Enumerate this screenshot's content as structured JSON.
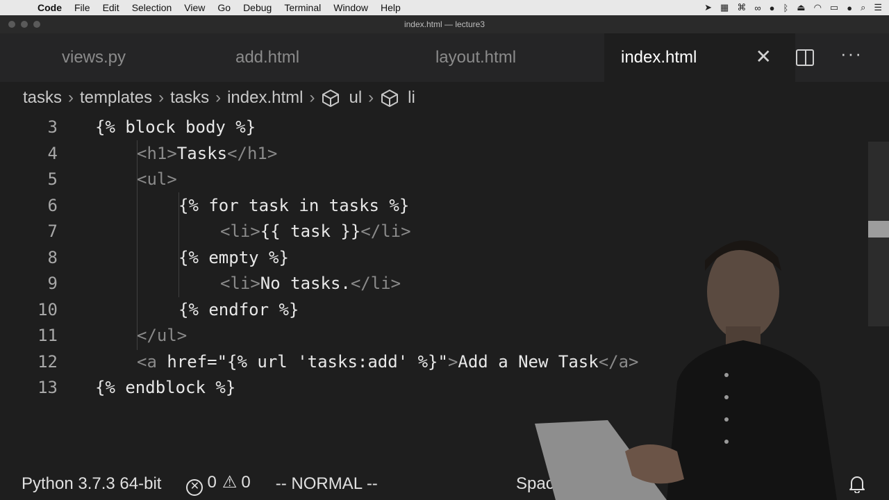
{
  "menubar": {
    "app": "Code",
    "items": [
      "File",
      "Edit",
      "Selection",
      "View",
      "Go",
      "Debug",
      "Terminal",
      "Window",
      "Help"
    ]
  },
  "window": {
    "title": "index.html — lecture3"
  },
  "tabs": [
    {
      "label": "views.py",
      "active": false
    },
    {
      "label": "add.html",
      "active": false
    },
    {
      "label": "layout.html",
      "active": false
    },
    {
      "label": "index.html",
      "active": true
    }
  ],
  "breadcrumb": [
    "tasks",
    "templates",
    "tasks",
    "index.html",
    "ul",
    "li"
  ],
  "editor": {
    "lines": [
      {
        "n": "3",
        "indent": 0,
        "parts": [
          [
            "txt",
            "{% block body %}"
          ]
        ]
      },
      {
        "n": "4",
        "indent": 1,
        "parts": [
          [
            "tag",
            "<h1>"
          ],
          [
            "txt",
            "Tasks"
          ],
          [
            "tag",
            "</h1>"
          ]
        ]
      },
      {
        "n": "5",
        "indent": 1,
        "parts": [
          [
            "tag",
            "<ul>"
          ]
        ]
      },
      {
        "n": "6",
        "indent": 2,
        "parts": [
          [
            "txt",
            "{% for task in tasks %}"
          ]
        ]
      },
      {
        "n": "7",
        "indent": 3,
        "parts": [
          [
            "tag",
            "<li>"
          ],
          [
            "txt",
            "{{ task }}"
          ],
          [
            "tag",
            "</li>"
          ]
        ]
      },
      {
        "n": "8",
        "indent": 2,
        "parts": [
          [
            "txt",
            "{% empty %}"
          ]
        ]
      },
      {
        "n": "9",
        "indent": 3,
        "parts": [
          [
            "tag",
            "<li>"
          ],
          [
            "txt",
            "No tasks."
          ],
          [
            "tag",
            "</li>"
          ]
        ]
      },
      {
        "n": "10",
        "indent": 2,
        "parts": [
          [
            "txt",
            "{% endfor %}"
          ]
        ]
      },
      {
        "n": "11",
        "indent": 1,
        "parts": [
          [
            "tag",
            "</ul>"
          ]
        ]
      },
      {
        "n": "12",
        "indent": 1,
        "parts": [
          [
            "tag",
            "<a "
          ],
          [
            "txt",
            "href=\"{% url 'tasks:add' %}\""
          ],
          [
            "tag",
            ">"
          ],
          [
            "txt",
            "Add a New Task"
          ],
          [
            "tag",
            "</a>"
          ]
        ]
      },
      {
        "n": "13",
        "indent": 0,
        "parts": [
          [
            "txt",
            "{% endblock %}"
          ]
        ]
      }
    ]
  },
  "statusbar": {
    "python": "Python 3.7.3 64-bit",
    "errors": "0",
    "warnings": "0",
    "mode": "-- NORMAL --",
    "spaces": "Spac"
  }
}
